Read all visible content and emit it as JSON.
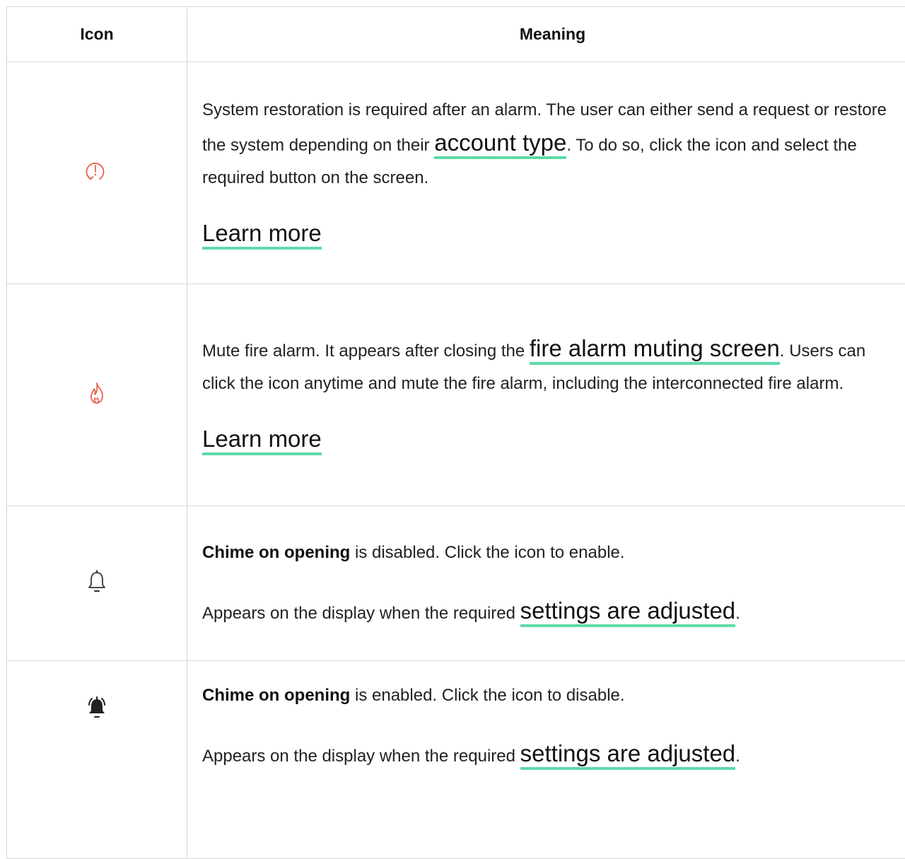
{
  "table": {
    "header": {
      "icon": "Icon",
      "meaning": "Meaning"
    },
    "rows": [
      {
        "icon": "restore-alarm-icon",
        "text_before": "System restoration is required after an alarm. The user can either send a request or restore the system depending on their ",
        "link": "account type",
        "text_after": ". To do so, click the icon and select the required button on the screen.",
        "learn_more": "Learn more"
      },
      {
        "icon": "fire-icon",
        "text_before": "Mute fire alarm. It appears after closing the ",
        "link": "fire alarm muting screen",
        "text_after": ". Users can click the icon anytime and mute the fire alarm, including the interconnected fire alarm.",
        "learn_more": "Learn more"
      },
      {
        "icon": "bell-outline-icon",
        "bold": "Chime on opening",
        "status_text": " is disabled. Click the icon to enable.",
        "appears_text": "Appears on the display when the required ",
        "link": "settings are adjusted",
        "period": "."
      },
      {
        "icon": "bell-ringing-icon",
        "bold": "Chime on opening",
        "status_text": " is enabled. Click the icon to disable.",
        "appears_text": "Appears on the display when the required ",
        "link": "settings are adjusted",
        "period": "."
      }
    ]
  },
  "colors": {
    "alert": "#e8614b",
    "link_underline": "#5fd9a8",
    "icon_dark": "#333333",
    "border": "#d7d7d7"
  }
}
